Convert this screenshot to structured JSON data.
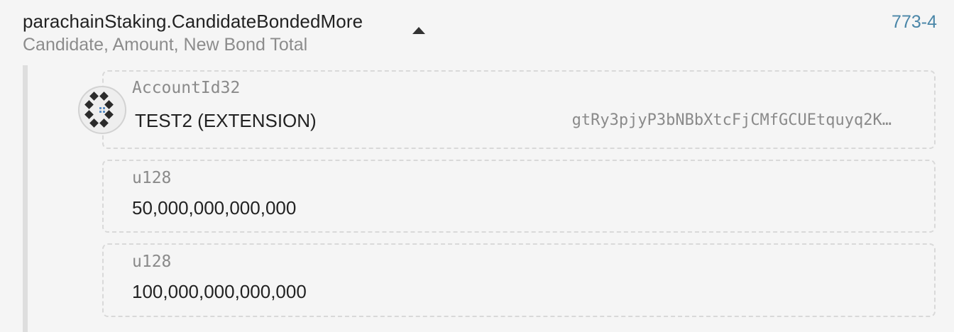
{
  "event": {
    "title": "parachainStaking.CandidateBondedMore",
    "subtitle": "Candidate, Amount, New Bond Total",
    "link": "773-4",
    "toggle_icon": "caret-up-icon"
  },
  "params": [
    {
      "type": "AccountId32",
      "account_name": "TEST2 (EXTENSION)",
      "address": "gtRy3pjyP3bNBbXtcFjCMfGCUEtquyq2K…",
      "icon": "identicon-icon"
    },
    {
      "type": "u128",
      "value": "50,000,000,000,000"
    },
    {
      "type": "u128",
      "value": "100,000,000,000,000"
    }
  ],
  "colors": {
    "link": "#4a86a8",
    "muted": "#8c8c8c",
    "text": "#222222",
    "identicon_dark": "#2b2b2b",
    "identicon_accent": "#5b8ec4"
  }
}
